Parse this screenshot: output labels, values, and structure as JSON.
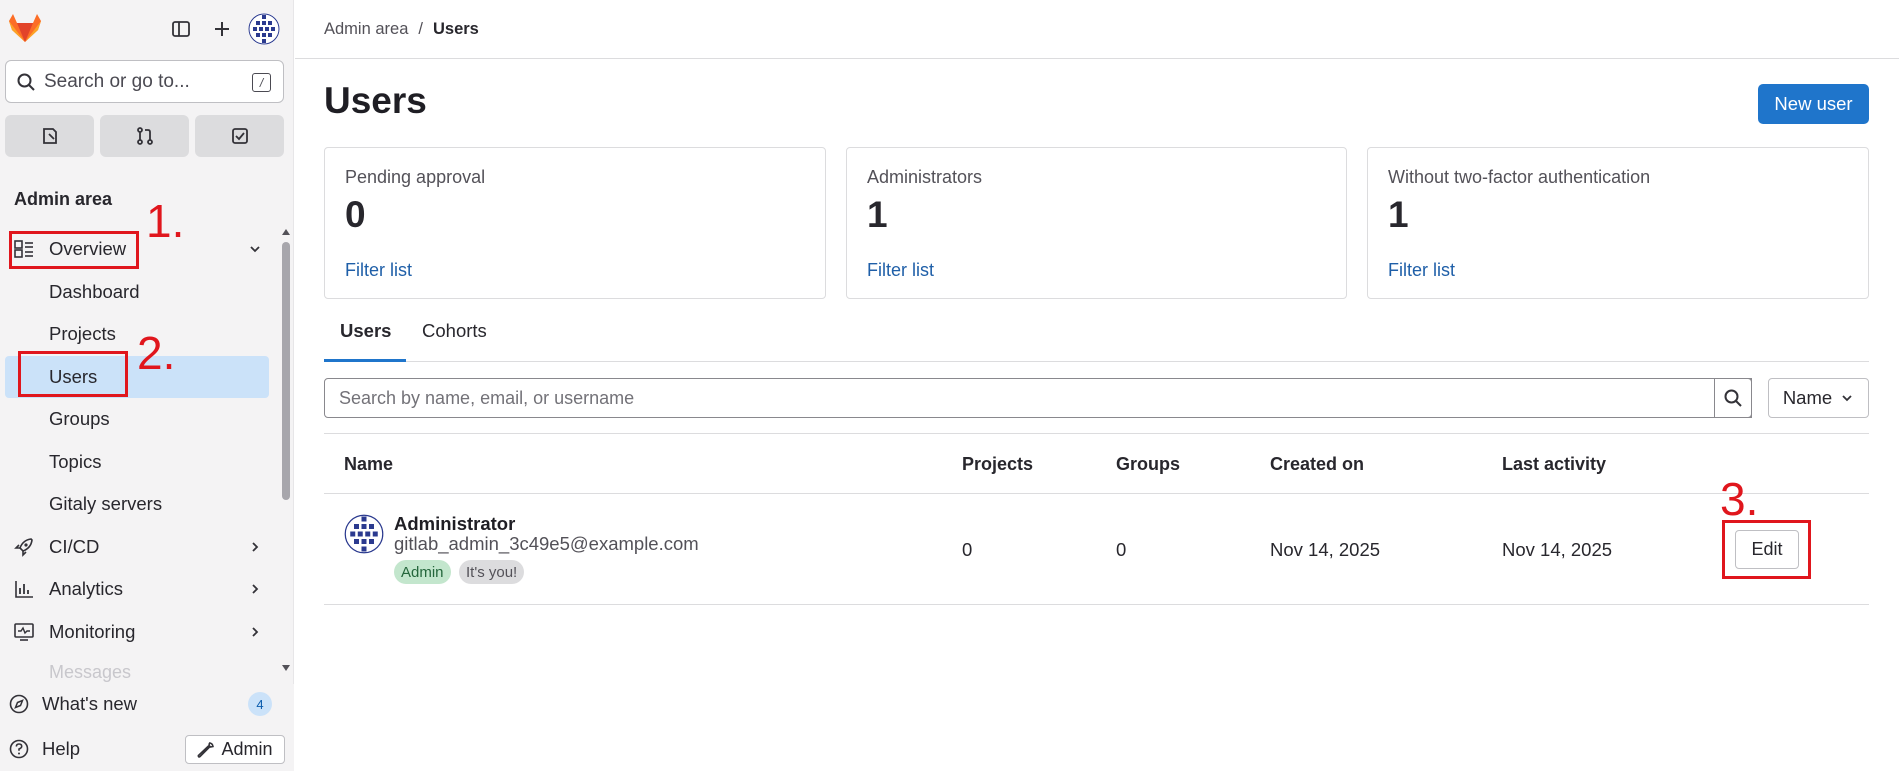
{
  "sidebar": {
    "search_placeholder": "Search or go to...",
    "search_shortcut": "/",
    "section_title": "Admin area",
    "nav": {
      "overview": "Overview",
      "dashboard": "Dashboard",
      "projects": "Projects",
      "users": "Users",
      "groups": "Groups",
      "topics": "Topics",
      "gitaly": "Gitaly servers",
      "cicd": "CI/CD",
      "analytics": "Analytics",
      "monitoring": "Monitoring",
      "messages": "Messages"
    },
    "whats_new": "What's new",
    "whats_new_count": "4",
    "help": "Help",
    "admin_button": "Admin"
  },
  "annotations": {
    "step1": "1.",
    "step2": "2.",
    "step3": "3."
  },
  "breadcrumb": {
    "parent": "Admin area",
    "separator": "/",
    "current": "Users"
  },
  "page": {
    "title": "Users",
    "new_user_button": "New user"
  },
  "stats": [
    {
      "title": "Pending approval",
      "value": "0",
      "link": "Filter list"
    },
    {
      "title": "Administrators",
      "value": "1",
      "link": "Filter list"
    },
    {
      "title": "Without two-factor authentication",
      "value": "1",
      "link": "Filter list"
    }
  ],
  "tabs": {
    "users": "Users",
    "cohorts": "Cohorts"
  },
  "user_search": {
    "placeholder": "Search by name, email, or username",
    "sort_label": "Name"
  },
  "table": {
    "headers": {
      "name": "Name",
      "projects": "Projects",
      "groups": "Groups",
      "created": "Created on",
      "activity": "Last activity"
    },
    "rows": [
      {
        "name": "Administrator",
        "email": "gitlab_admin_3c49e5@example.com",
        "badge_admin": "Admin",
        "badge_you": "It's you!",
        "projects": "0",
        "groups": "0",
        "created": "Nov 14, 2025",
        "activity": "Nov 14, 2025",
        "edit_label": "Edit"
      }
    ]
  },
  "colors": {
    "primary": "#1f75cb",
    "annotation": "#e0161d",
    "active_nav": "#cbe2f9"
  }
}
